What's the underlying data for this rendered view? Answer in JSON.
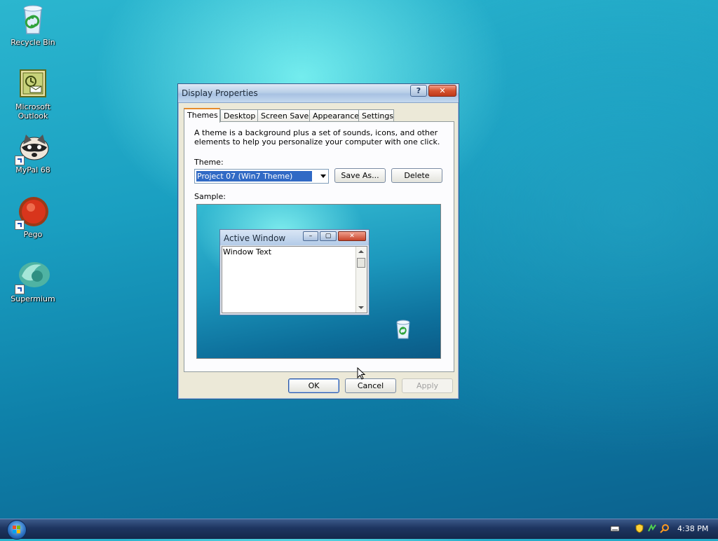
{
  "desktop": {
    "icons": [
      {
        "label": "Recycle Bin"
      },
      {
        "label": "Microsoft Outlook"
      },
      {
        "label": "MyPal 68"
      },
      {
        "label": "Pego"
      },
      {
        "label": "Supermium"
      }
    ]
  },
  "dialog": {
    "title": "Display Properties",
    "help_label": "?",
    "close_label": "✕",
    "tabs": [
      "Themes",
      "Desktop",
      "Screen Saver",
      "Appearance",
      "Settings"
    ],
    "active_tab": "Themes",
    "description": "A theme is a background plus a set of sounds, icons, and other elements to help you personalize your computer with one click.",
    "theme_label": "Theme:",
    "theme_value": "Project 07 (Win7 Theme)",
    "save_as_label": "Save As...",
    "delete_label": "Delete",
    "sample_label": "Sample:",
    "sample": {
      "window_title": "Active Window",
      "window_text": "Window Text"
    },
    "ok_label": "OK",
    "cancel_label": "Cancel",
    "apply_label": "Apply"
  },
  "taskbar": {
    "clock": "4:38 PM"
  },
  "colors": {
    "selection": "#316ac5",
    "active_tab_accent": "#e68b2c"
  }
}
